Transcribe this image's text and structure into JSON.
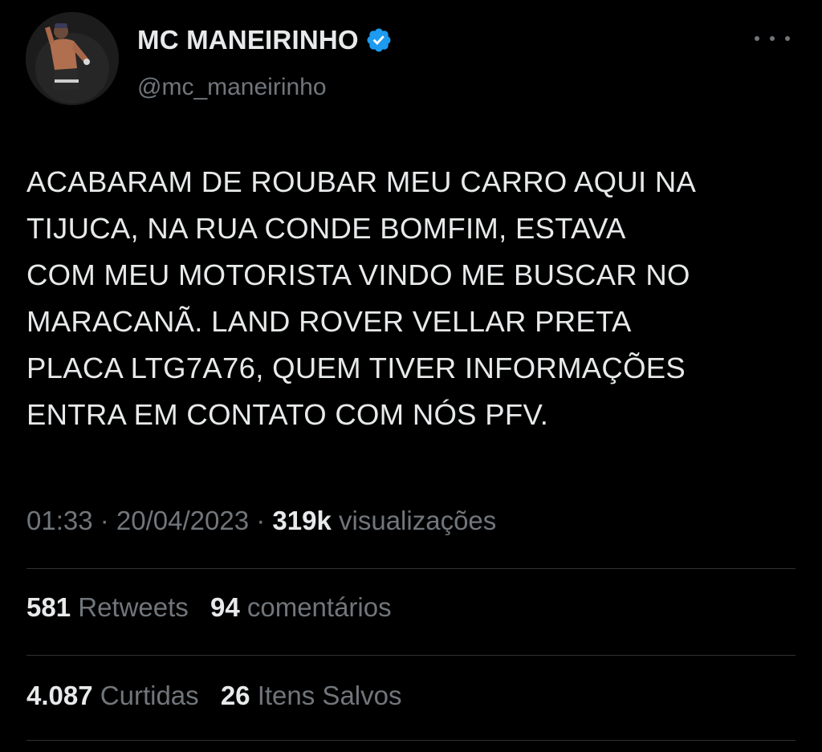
{
  "author": {
    "display_name": "MC MANEIRINHO",
    "handle": "@mc_maneirinho",
    "verified_icon": "verified-badge-icon",
    "avatar_icon": "avatar-photo"
  },
  "tweet": {
    "text": "ACABARAM DE ROUBAR MEU CARRO AQUI NA\nTIJUCA, NA RUA CONDE BOMFIM, ESTAVA\nCOM MEU MOTORISTA VINDO ME BUSCAR NO\nMARACANÃ. LAND ROVER VELLAR PRETA\nPLACA LTG7A76, QUEM TIVER INFORMAÇÕES\nENTRA EM CONTATO COM NÓS PFV.",
    "time": "01:33",
    "date": "20/04/2023",
    "separator": " · ",
    "views_count": "319k",
    "views_label": "visualizações"
  },
  "stats": {
    "retweets_count": "581",
    "retweets_label": "Retweets",
    "comments_count": "94",
    "comments_label": "comentários",
    "likes_count": "4.087",
    "likes_label": "Curtidas",
    "saves_count": "26",
    "saves_label": "Itens Salvos"
  },
  "colors": {
    "background": "#000000",
    "text_primary": "#e7e9ea",
    "text_secondary": "#71767b",
    "divider": "#2f3336",
    "verified_blue": "#1d9bf0"
  }
}
